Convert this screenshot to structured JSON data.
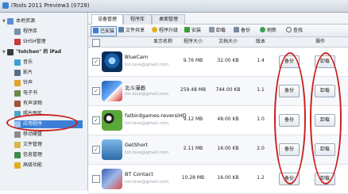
{
  "window": {
    "title": "iTools 2011 Preview3 (0728)"
  },
  "sidebar": {
    "local_group": "本地资源",
    "local_items": [
      "程序库",
      "SHSH管理"
    ],
    "device_group": "\"totchen\" 的 iPad",
    "device_items": [
      "音乐",
      "影片",
      "铃声",
      "电子书",
      "有声读物",
      "照片图库",
      "应用程序",
      "移动硬盘",
      "文件管理",
      "信息管理",
      "高级功能"
    ]
  },
  "tabs": [
    "设备管理",
    "程序库",
    "桌面管理"
  ],
  "toolbar": [
    "已安装",
    "文件共享",
    "程序升级",
    "安装",
    "卸载",
    "备份",
    "刷新",
    "查找"
  ],
  "table": {
    "headers": [
      "显示名称",
      "程序大小",
      "文档大小",
      "版本",
      "操作"
    ],
    "rows": [
      {
        "name": "BlueCam",
        "email": "tot.love@gmail.com",
        "app_size": "9.76 MB",
        "doc_size": "32.00 KB",
        "version": "1.4",
        "checked": true
      },
      {
        "name": "北斗漫画",
        "email": "tot.love@gmail.com",
        "app_size": "259.48 MB",
        "doc_size": "744.00 KB",
        "version": "1.1",
        "checked": true
      },
      {
        "name": "fatbirdgames-reversiHD",
        "email": "tot.love@gmail.com",
        "app_size": "9.12 MB",
        "doc_size": "48.00 KB",
        "version": "1.0",
        "checked": true
      },
      {
        "name": "GetShort",
        "email": "tot.love@gmail.com",
        "app_size": "2.11 MB",
        "doc_size": "16.00 KB",
        "version": "2.0",
        "checked": true
      },
      {
        "name": "BT Contact",
        "email": "tot.love@gmail.com",
        "app_size": "10.28 MB",
        "doc_size": "16.00 KB",
        "version": "1.2",
        "checked": false
      }
    ],
    "backup_label": "备份",
    "uninstall_label": "卸载",
    "check_mark": "✓"
  },
  "colors": {
    "accent": "#3d7fd6",
    "annotation": "#cc1f1f"
  }
}
